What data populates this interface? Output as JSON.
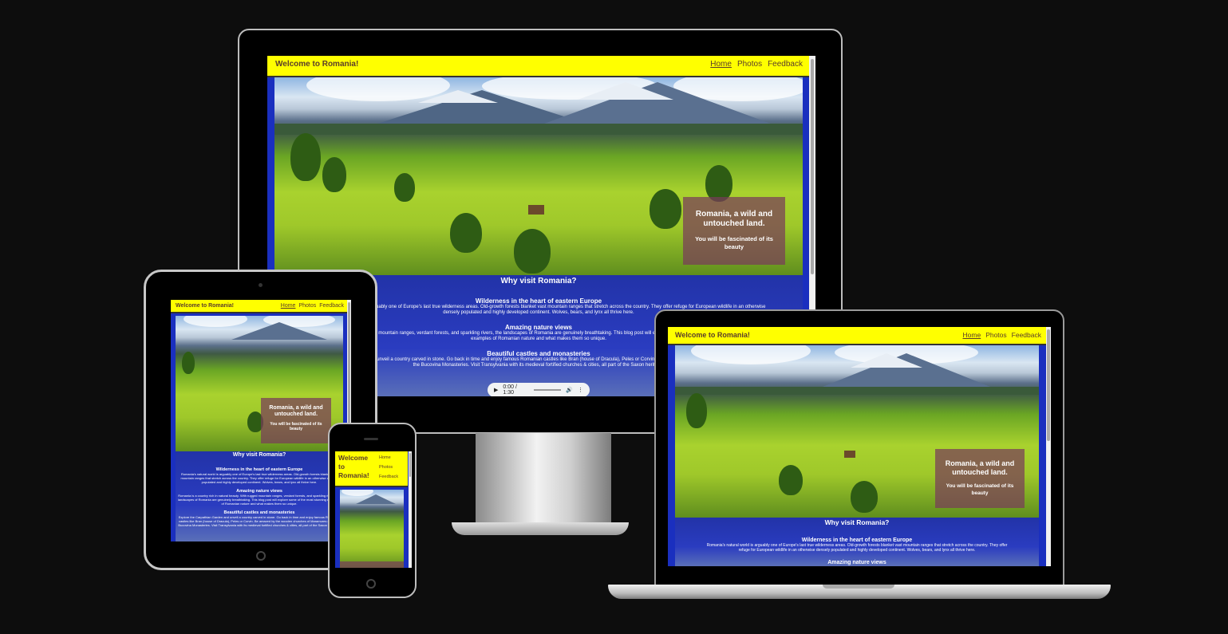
{
  "site": {
    "title": "Welcome to Romania!",
    "nav": [
      "Home",
      "Photos",
      "Feedback"
    ],
    "hero_heading": "Romania, a wild and untouched land.",
    "hero_sub": "You will be fascinated of its beauty",
    "why": "Why visit Romania?",
    "sections": [
      {
        "heading": "Wilderness in the heart of eastern Europe",
        "text": "Romania's natural world is arguably one of Europe's last true wilderness areas. Old-growth forests blanket vast mountain ranges that stretch across the country. They offer refuge for European wildlife in an otherwise densely populated and highly developed continent. Wolves, bears, and lynx all thrive here."
      },
      {
        "heading": "Amazing nature views",
        "text": "Romania is a country rich in natural beauty. With rugged mountain ranges, verdant forests, and sparkling rivers, the landscapes of Romania are genuinely breathtaking. This blog post will explore some of the most stunning examples of Romanian nature and what makes them so unique."
      },
      {
        "heading": "Beautiful castles and monasteries",
        "text": "Explore the Carpathian Garden and unveil a country carved in stone. Go back in time and enjoy famous Romanian castles like Bran (house of Dracula), Peles or Corvin. Be amazed by the wooden churches of Maramures or by the Bucovina Monasteries. Visit Transylvania with its medieval fortified churches & cities, all part of the Saxon heritage."
      }
    ],
    "audio_time": "0:00 / 1:30"
  },
  "monitor": {
    "sec0_frag": "Old-growth forests blanket vast mountain ranges that stretch across the country. They offer refuge for European wildlife in an otherwise",
    "sec0_line1": "Romania's natural world is arguably one of Europe's last true wilderness areas.",
    "sec0_line2": "densely populated and highly developed continent. Wolves, bears, and lynx all thrive here.",
    "sec1_line1": "With rugged mountain ranges, verdant forests, and sparkling rivers, the landscapes of Romania are genuinely breathtaking. This blog post will explore some of the most stunning",
    "sec1_line2": "examples of Romanian nature and what makes them so unique.",
    "sec2_line1": "Explore the Carpathian Garden and unveil a country carved in stone. Go back in time and enjoy famous Romanian castles like Bran (house of Dracula), Peles or Corvin. Be amazed by the wooden churches of Maramures or by",
    "sec2_line2": "the Bucovina Monasteries. Visit Transylvania with its medieval fortified churches & cities, all part of the Saxon heritage."
  },
  "laptop": {
    "sec0_line1": "Romania's natural world is arguably one of Europe's last true wilderness areas. Old-growth forests blanket vast mountain ranges that stretch across the country. They offer",
    "sec0_line2": "refuge for European wildlife in an otherwise densely populated and highly developed continent. Wolves, bears, and lynx all thrive here.",
    "sec1_heading_partial": "Amazing nature views"
  },
  "phone": {
    "title_lines": [
      "Welcome",
      "to",
      "Romania!"
    ]
  },
  "colors": {
    "header_bg": "#ffff00",
    "side_bar": "#1a2fbf",
    "content_bg": "#2233a8",
    "card_bg": "#7a3c5a"
  }
}
